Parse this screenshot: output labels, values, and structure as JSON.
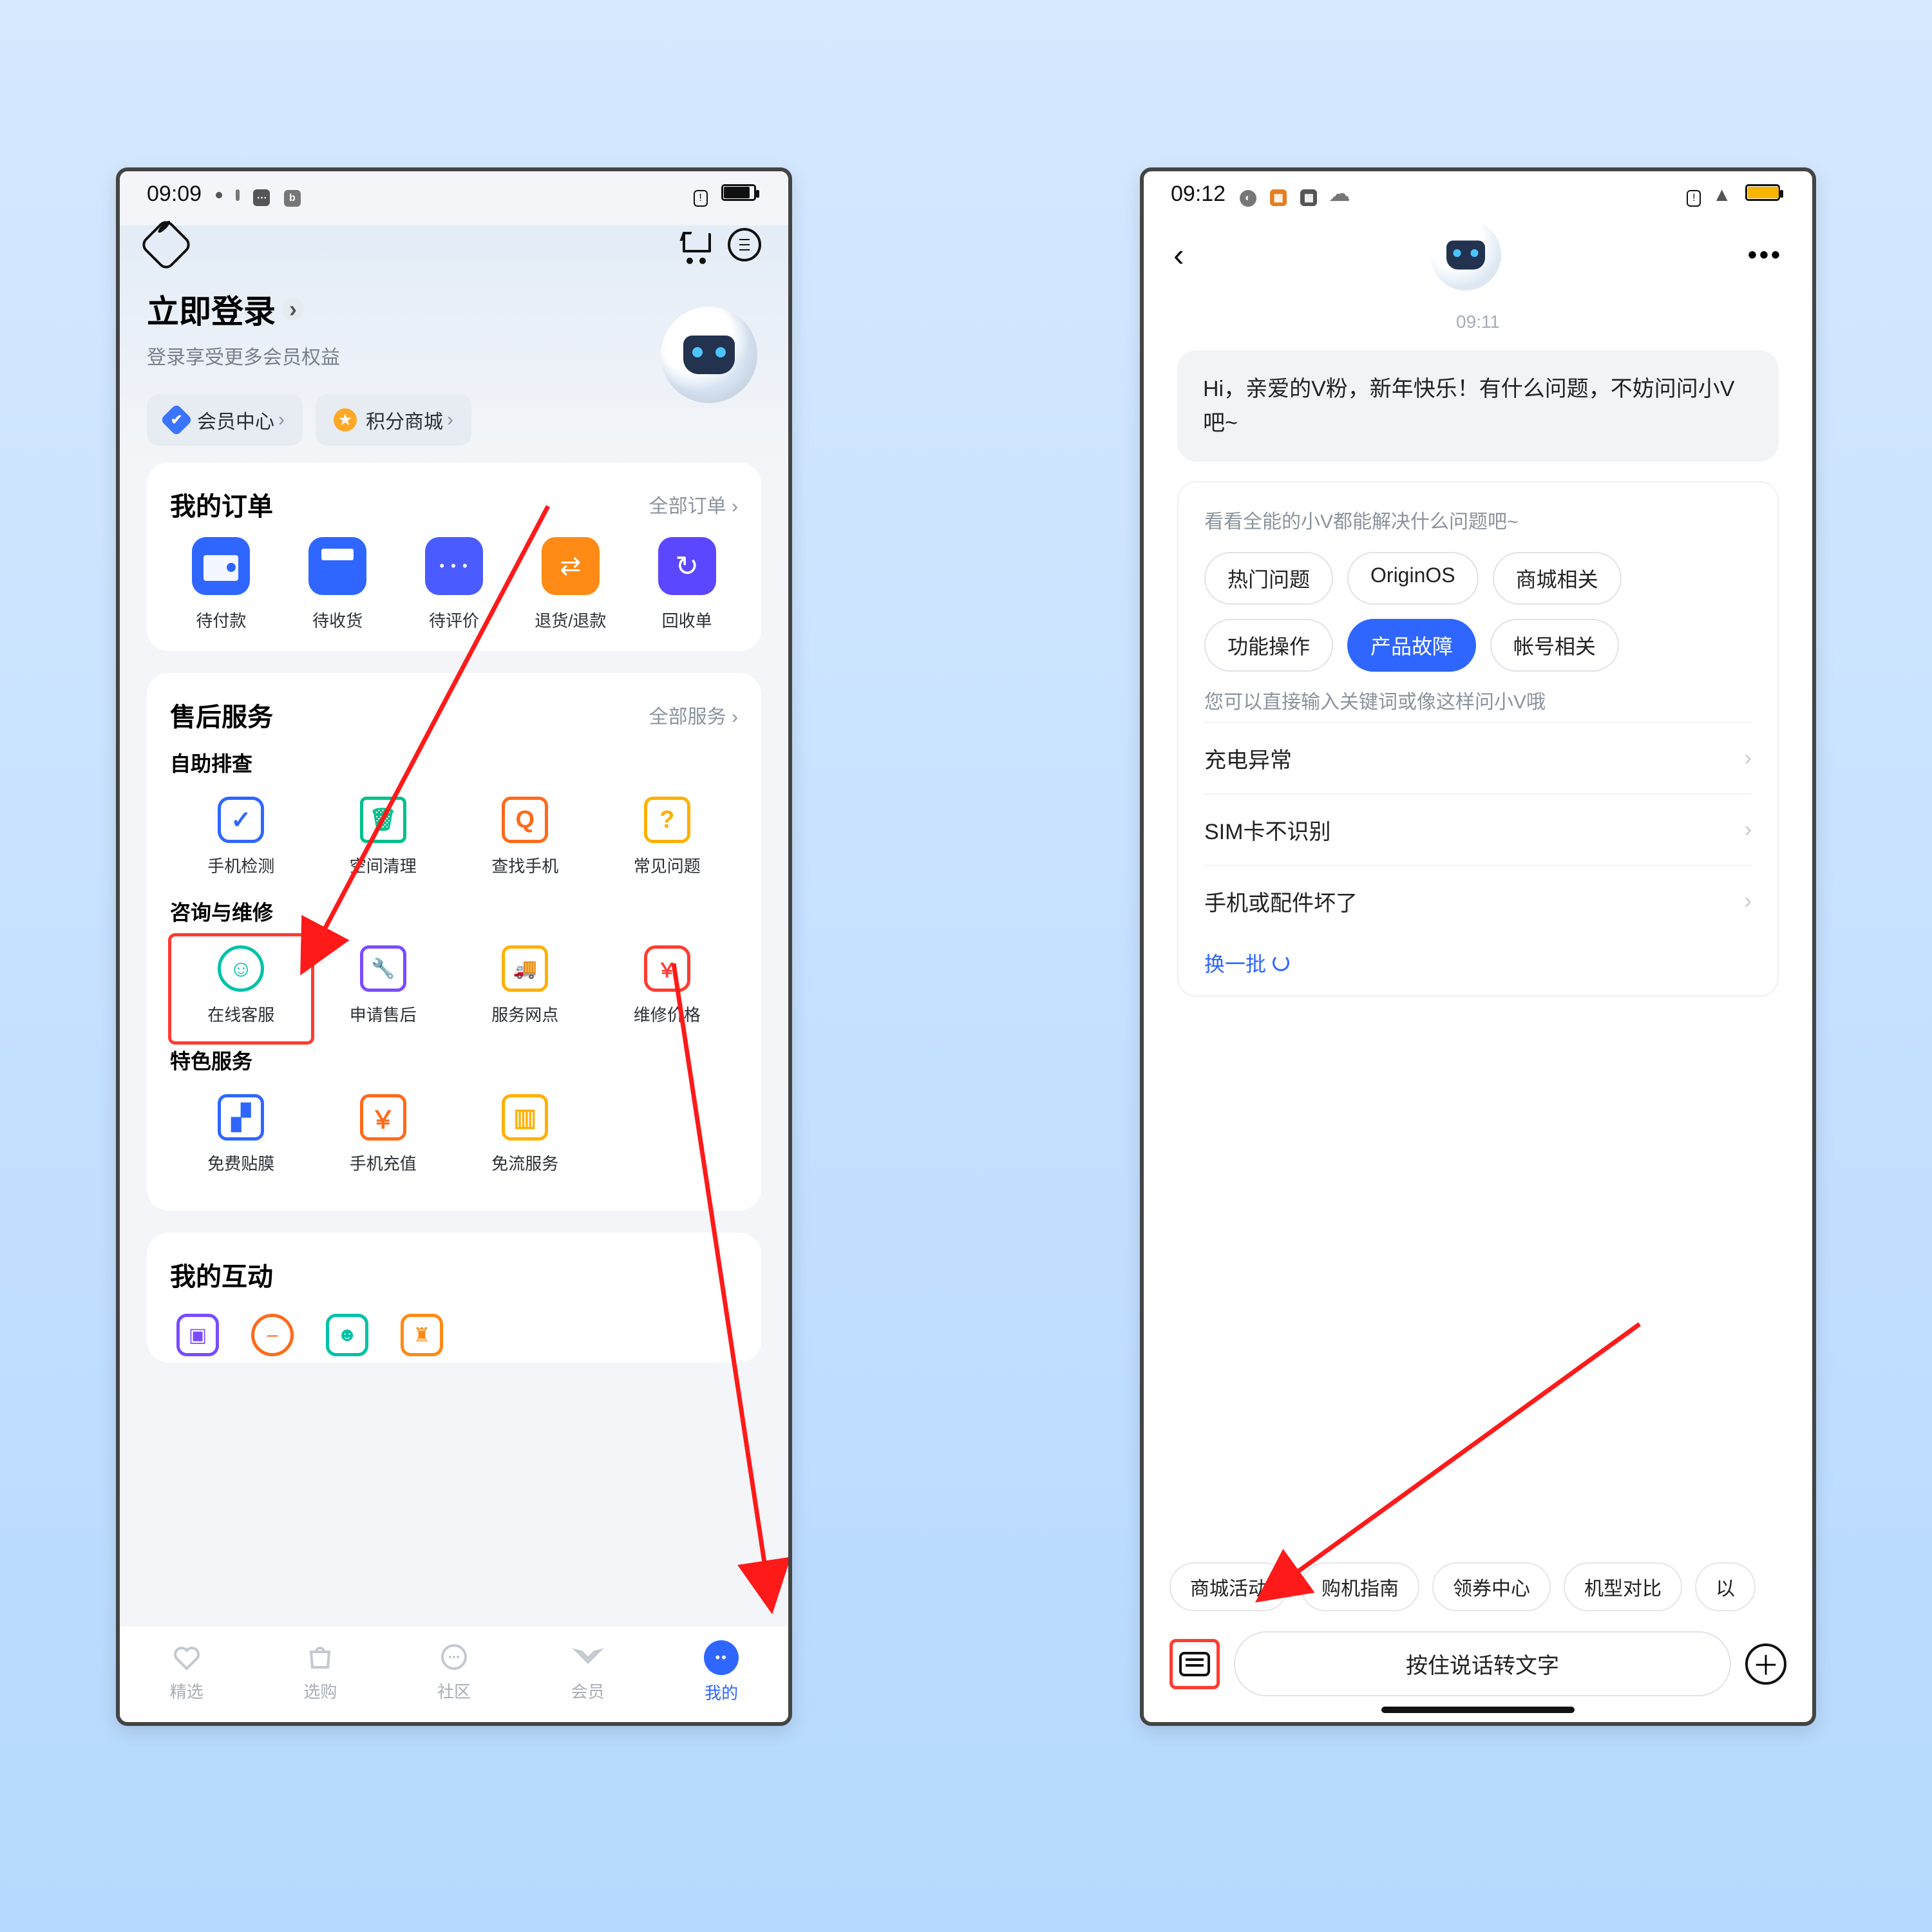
{
  "left": {
    "status_time": "09:09",
    "login_title": "立即登录",
    "login_sub": "登录享受更多会员权益",
    "pill_member": "会员中心",
    "pill_points": "积分商城",
    "orders_title": "我的订单",
    "orders_all": "全部订单 ›",
    "orders": [
      "待付款",
      "待收货",
      "待评价",
      "退货/退款",
      "回收单"
    ],
    "service_title": "售后服务",
    "service_all": "全部服务 ›",
    "sub1": "自助排查",
    "s1": [
      "手机检测",
      "空间清理",
      "查找手机",
      "常见问题"
    ],
    "sub2": "咨询与维修",
    "s2": [
      "在线客服",
      "申请售后",
      "服务网点",
      "维修价格"
    ],
    "sub3": "特色服务",
    "s3": [
      "免费贴膜",
      "手机充值",
      "免流服务"
    ],
    "interact_title": "我的互动",
    "tabs": [
      "精选",
      "选购",
      "社区",
      "会员",
      "我的"
    ]
  },
  "right": {
    "status_time": "09:12",
    "timestamp": "09:11",
    "greeting": "Hi，亲爱的V粉，新年快乐！有什么问题，不妨问问小V吧~",
    "hint": "看看全能的小V都能解决什么问题吧~",
    "chips": [
      "热门问题",
      "OriginOS",
      "商城相关",
      "功能操作",
      "产品故障",
      "帐号相关"
    ],
    "hint2": "您可以直接输入关键词或像这样问小V哦",
    "questions": [
      "充电异常",
      "SIM卡不识别",
      "手机或配件坏了"
    ],
    "refresh": "换一批",
    "quick": [
      "商城活动",
      "购机指南",
      "领券中心",
      "机型对比",
      "以"
    ],
    "voice": "按住说话转文字"
  }
}
